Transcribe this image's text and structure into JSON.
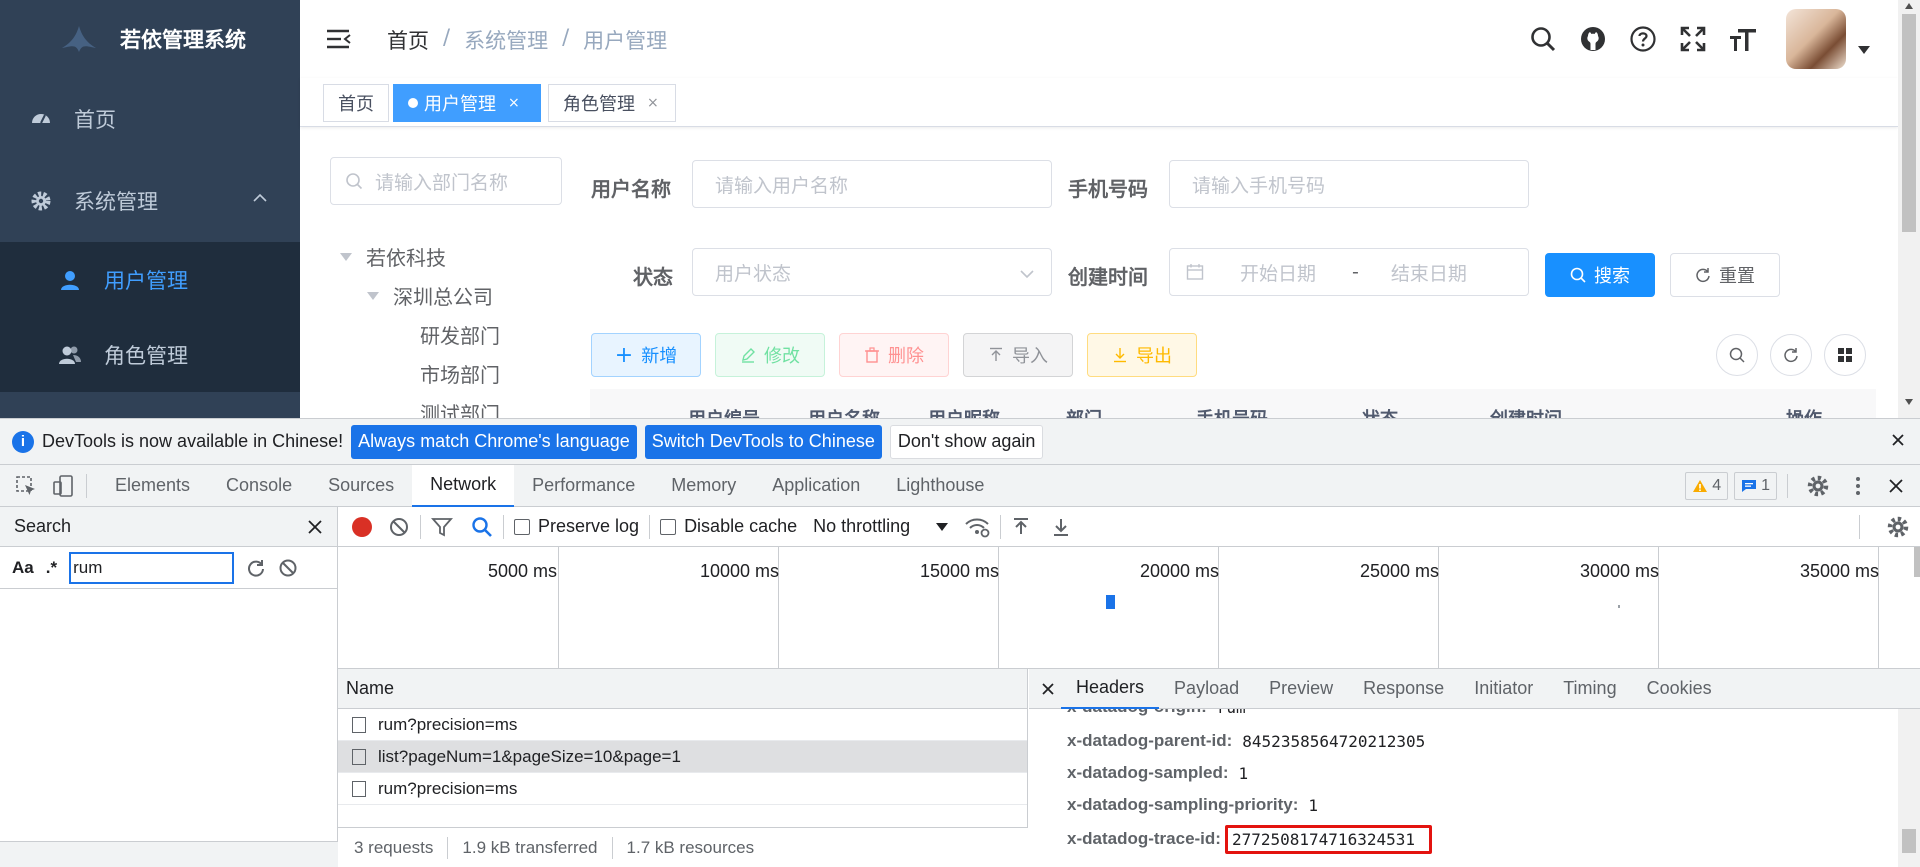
{
  "app": {
    "title": "若依管理系统",
    "menu": [
      {
        "label": "首页",
        "icon": "dashboard-icon"
      },
      {
        "label": "系统管理",
        "icon": "gear-icon"
      }
    ],
    "submenu": [
      {
        "label": "用户管理",
        "icon": "user-icon",
        "active": true
      },
      {
        "label": "角色管理",
        "icon": "users-icon",
        "active": false
      }
    ],
    "breadcrumb": [
      "首页",
      "/",
      "系统管理",
      "/",
      "用户管理"
    ],
    "tags": [
      {
        "label": "首页",
        "active": false
      },
      {
        "label": "用户管理",
        "active": true,
        "close": "×"
      },
      {
        "label": "角色管理",
        "active": false,
        "close": "×"
      }
    ],
    "dept_search_placeholder": "请输入部门名称",
    "tree": [
      {
        "label": "若依科技",
        "level": 0,
        "expanded": true
      },
      {
        "label": "深圳总公司",
        "level": 1,
        "expanded": true
      },
      {
        "label": "研发部门",
        "level": 2
      },
      {
        "label": "市场部门",
        "level": 2
      },
      {
        "label": "测试部门",
        "level": 2
      }
    ],
    "filters": {
      "username_label": "用户名称",
      "username_placeholder": "请输入用户名称",
      "phone_label": "手机号码",
      "phone_placeholder": "请输入手机号码",
      "status_label": "状态",
      "status_placeholder": "用户状态",
      "created_label": "创建时间",
      "start_placeholder": "开始日期",
      "range_sep": "-",
      "end_placeholder": "结束日期",
      "search_btn": "搜索",
      "reset_btn": "重置"
    },
    "actions": {
      "add": "新增",
      "edit": "修改",
      "delete": "删除",
      "import": "导入",
      "export": "导出"
    },
    "table_headers": [
      "用户编号",
      "用户名称",
      "用户昵称",
      "部门",
      "手机号码",
      "状态",
      "创建时间",
      "操作"
    ]
  },
  "devtools": {
    "infobar": {
      "message": "DevTools is now available in Chinese!",
      "btn_match": "Always match Chrome's language",
      "btn_switch": "Switch DevTools to Chinese",
      "btn_dismiss": "Don't show again"
    },
    "tabs": [
      "Elements",
      "Console",
      "Sources",
      "Network",
      "Performance",
      "Memory",
      "Application",
      "Lighthouse"
    ],
    "active_tab": "Network",
    "warnings": "4",
    "messages": "1",
    "search": {
      "title": "Search",
      "case_label": "Aa",
      "regex_label": ".*",
      "query": "rum"
    },
    "toolbar": {
      "preserve_log": "Preserve log",
      "disable_cache": "Disable cache",
      "throttling": "No throttling"
    },
    "timeline_ticks": [
      "5000 ms",
      "10000 ms",
      "15000 ms",
      "20000 ms",
      "25000 ms",
      "30000 ms",
      "35000 ms"
    ],
    "list_header": "Name",
    "requests": [
      {
        "name": "rum?precision=ms",
        "selected": false
      },
      {
        "name": "list?pageNum=1&pageSize=10&page=1",
        "selected": true
      },
      {
        "name": "rum?precision=ms",
        "selected": false
      }
    ],
    "status": {
      "requests": "3 requests",
      "transferred": "1.9 kB transferred",
      "resources": "1.7 kB resources"
    },
    "detail_tabs": [
      "Headers",
      "Payload",
      "Preview",
      "Response",
      "Initiator",
      "Timing",
      "Cookies"
    ],
    "detail_active": "Headers",
    "headers": [
      {
        "name": "x-datadog-origin:",
        "value": "rum"
      },
      {
        "name": "x-datadog-parent-id:",
        "value": "8452358564720212305"
      },
      {
        "name": "x-datadog-sampled:",
        "value": "1"
      },
      {
        "name": "x-datadog-sampling-priority:",
        "value": "1"
      },
      {
        "name": "x-datadog-trace-id:",
        "value": "2772508174716324531",
        "highlighted": true
      }
    ],
    "colors": {
      "accent": "#1a73e8",
      "highlight": "#e3130f"
    }
  }
}
